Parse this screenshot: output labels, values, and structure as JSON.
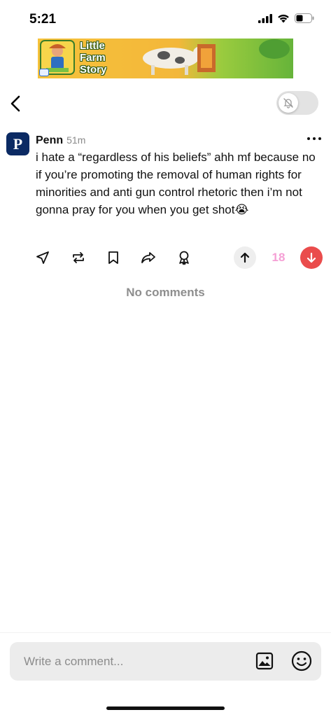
{
  "status_bar": {
    "time": "5:21",
    "icons": [
      "cellular-signal-icon",
      "wifi-icon",
      "battery-icon"
    ]
  },
  "ad": {
    "title": "Little Farm Story"
  },
  "nav": {
    "back_icon": "chevron-left-icon",
    "notifications_toggle_icon": "bell-slash-icon",
    "notifications_enabled": false
  },
  "post": {
    "avatar_letter": "P",
    "author": "Penn",
    "time_ago": "51m",
    "text": "i hate a “regardless of his beliefs” ahh mf because no if you’re promoting the removal of human rights for minorities and anti gun control rhetoric then i’m not gonna pray for you when you get shot😭",
    "more_icon": "more-horizontal-icon",
    "actions": [
      "send-icon",
      "repost-icon",
      "bookmark-icon",
      "share-icon",
      "award-icon"
    ],
    "score": "18",
    "vote_colors": {
      "score": "#f59fd5",
      "downvote": "#ea4c4c"
    }
  },
  "comments": {
    "empty_label": "No comments"
  },
  "composer": {
    "placeholder": "Write a comment...",
    "image_icon": "image-icon",
    "emoji_icon": "emoji-icon"
  }
}
